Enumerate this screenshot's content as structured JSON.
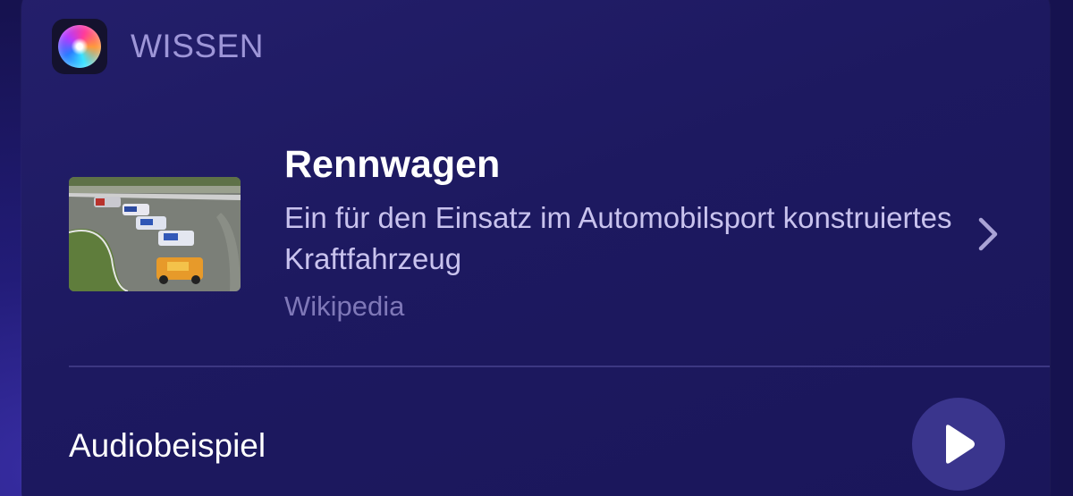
{
  "section": {
    "title": "WISSEN",
    "icon": "siri-icon"
  },
  "result": {
    "title": "Rennwagen",
    "description": "Ein für den Einsatz im Automobilsport konstruiertes Kraftfahrzeug",
    "source": "Wikipedia",
    "thumbnail": "race-cars-on-track-image",
    "chevron_icon": "chevron-right-icon"
  },
  "audio": {
    "label": "Audiobeispiel",
    "play_icon": "play-icon"
  },
  "colors": {
    "background": "#1d1960",
    "header_text": "#9e96d8",
    "description_text": "#c9c3ee",
    "source_text": "#7f78b8",
    "play_button": "#3a358d"
  }
}
